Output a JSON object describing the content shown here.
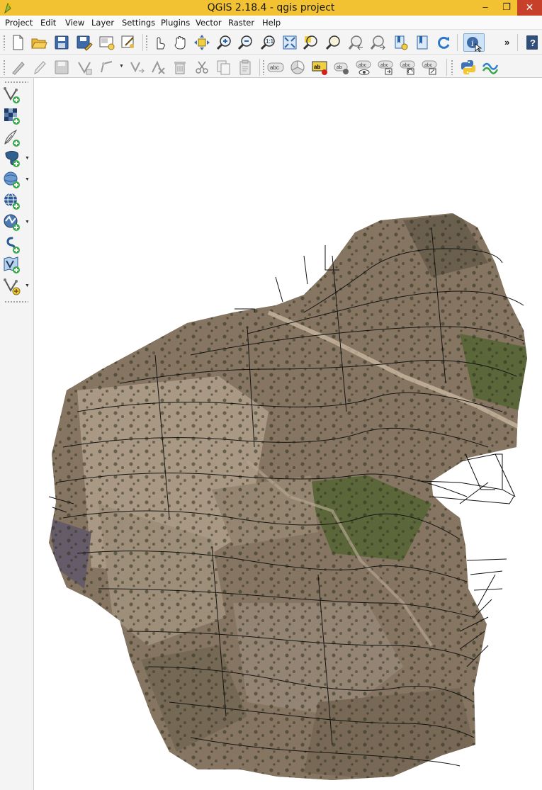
{
  "window": {
    "title": "QGIS 2.18.4 - qgis project",
    "minimize_glyph": "–",
    "maximize_glyph": "❐",
    "close_glyph": "✕",
    "accent_color": "#f2c233",
    "close_color": "#c7402a"
  },
  "menu": {
    "items": [
      "Project",
      "Edit",
      "View",
      "Layer",
      "Settings",
      "Plugins",
      "Vector",
      "Raster",
      "Help"
    ]
  },
  "toolbar_file": {
    "icons": [
      "new-project-icon",
      "open-project-icon",
      "save-project-icon",
      "save-as-icon",
      "new-print-composer-icon",
      "composer-manager-icon"
    ]
  },
  "toolbar_map_nav": {
    "icons": [
      "touch-zoom-pan-icon",
      "pan-map-icon",
      "pan-to-selection-icon",
      "zoom-in-icon",
      "zoom-out-icon",
      "zoom-native-resolution-icon",
      "zoom-full-icon",
      "zoom-to-selection-icon",
      "zoom-to-layer-icon",
      "zoom-last-icon",
      "zoom-next-icon",
      "new-bookmark-icon",
      "show-bookmarks-icon",
      "refresh-icon"
    ],
    "identify_icon": "identify-features-icon",
    "overflow_glyph": "»",
    "help_icon": "whats-this-icon"
  },
  "toolbar_digitize": {
    "icons": [
      "current-edits-icon",
      "toggle-editing-icon",
      "save-layer-edits-icon",
      "add-feature-icon",
      "node-tool-icon",
      "move-feature-icon",
      "delete-part-icon",
      "delete-selected-icon",
      "cut-features-icon",
      "copy-features-icon",
      "paste-features-icon"
    ]
  },
  "toolbar_labels": {
    "icons": [
      "layer-labeling-icon",
      "layer-diagram-icon",
      "highlight-pinned-labels-icon",
      "pin-labels-icon",
      "show-hide-labels-icon",
      "move-label-icon",
      "rotate-label-icon",
      "change-label-icon"
    ],
    "label_text": "abc"
  },
  "toolbar_plugins": {
    "icons": [
      "python-console-icon",
      "profile-tool-icon"
    ]
  },
  "manage_layers": {
    "items": [
      {
        "icon": "add-vector-layer-icon",
        "dropdown": false
      },
      {
        "icon": "add-raster-layer-icon",
        "dropdown": false
      },
      {
        "icon": "add-delimited-text-icon",
        "dropdown": false
      },
      {
        "icon": "add-postgis-layer-icon",
        "dropdown": true
      },
      {
        "icon": "add-spatialite-layer-icon",
        "dropdown": true
      },
      {
        "icon": "add-wms-layer-icon",
        "dropdown": false
      },
      {
        "icon": "add-wcs-layer-icon",
        "dropdown": true
      },
      {
        "icon": "add-wfs-layer-icon",
        "dropdown": false
      },
      {
        "icon": "add-virtual-layer-icon",
        "dropdown": false
      },
      {
        "icon": "new-shapefile-layer-icon",
        "dropdown": true
      }
    ],
    "dropdown_glyph": "▼"
  },
  "map_canvas": {
    "background_color": "#ffffff",
    "layer_raster": "orthophoto-mosaic",
    "layer_vector": "contour-lines",
    "raster_colors": [
      "#8b7a66",
      "#6f6351",
      "#9a8a78",
      "#5f6b3c",
      "#b09f8a"
    ]
  }
}
